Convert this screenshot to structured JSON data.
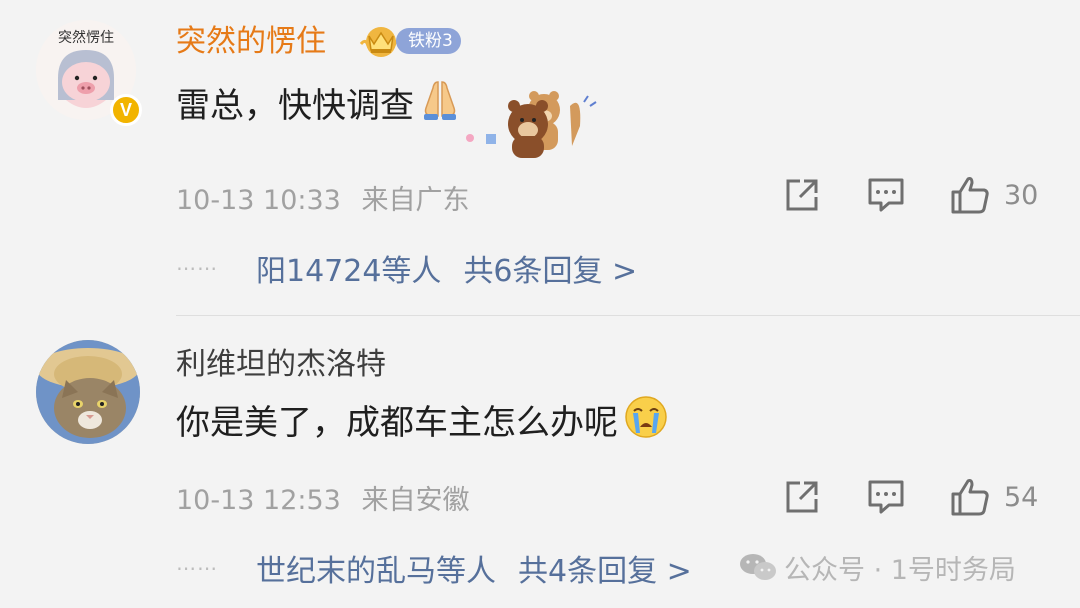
{
  "comments": [
    {
      "user": "突然的愣住",
      "avatar_text": "突然愣住",
      "verified": "V",
      "fan_badge": {
        "icon": "crown-icon",
        "label": "铁粉3"
      },
      "text": "雷总，快快调查",
      "text_emoji": "🙏",
      "sticker": "bear-sticker",
      "time": "10-13 10:33",
      "location": "来自广东",
      "likes": "30",
      "reply_users": "阳14724等人",
      "reply_count": "共6条回复 >"
    },
    {
      "user": "利维坦的杰洛特",
      "avatar": "cat-avatar",
      "text": "你是美了，成都车主怎么办呢",
      "text_emoji": "😭",
      "time": "10-13 12:53",
      "location": "来自安徽",
      "likes": "54",
      "reply_users": "世纪末的乱马等人",
      "reply_count": "共4条回复 >"
    }
  ],
  "reply_dots": "⋯⋯",
  "watermark": {
    "icon": "wechat-icon",
    "text": "公众号 · 1号时务局"
  },
  "colors": {
    "username_fan": "#e67a17",
    "link": "#56709b",
    "meta": "#a1a1a1",
    "badge": "#8ea4d8"
  }
}
